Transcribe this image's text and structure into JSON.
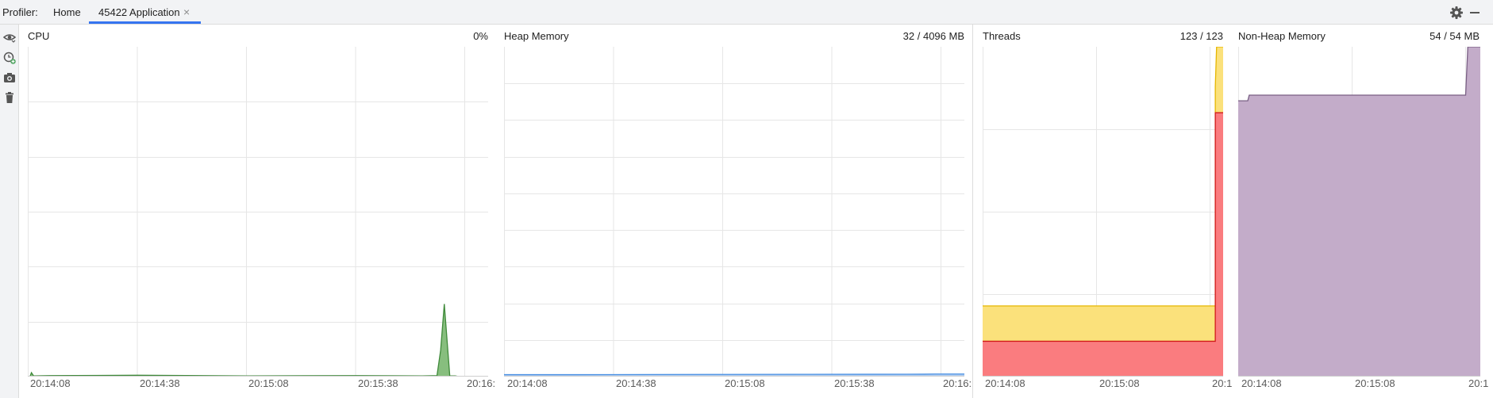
{
  "toolbar": {
    "profiler_label": "Profiler:",
    "tabs": [
      {
        "label": "Home"
      },
      {
        "label": "45422 Application",
        "active": true
      }
    ],
    "close_glyph": "×",
    "settings_icon": "gear-icon",
    "minimize_icon": "minimize-icon"
  },
  "left_toolbar": {
    "icons": [
      "eye-icon",
      "add-clock-icon",
      "camera-icon",
      "trash-icon"
    ]
  },
  "colors": {
    "cpu": "#5fa853",
    "heap": "#4a90e2",
    "threads_running": "#fa7c7f",
    "threads_waiting": "#fbe17b",
    "nonheap": "#c3acc9",
    "grid": "#e6e6e6"
  },
  "panels": {
    "cpu": {
      "title": "CPU",
      "value": "0%",
      "ticks": [
        "20:14:08",
        "20:14:38",
        "20:15:08",
        "20:15:38",
        "20:16:"
      ]
    },
    "heap": {
      "title": "Heap Memory",
      "value": "32 / 4096 MB",
      "ticks": [
        "20:14:08",
        "20:14:38",
        "20:15:08",
        "20:15:38",
        "20:16:"
      ]
    },
    "threads": {
      "title": "Threads",
      "value": "123 / 123",
      "ticks": [
        "20:14:08",
        "20:15:08",
        "20:1"
      ]
    },
    "nonheap": {
      "title": "Non-Heap Memory",
      "value": "54 / 54 MB",
      "ticks": [
        "20:14:08",
        "20:15:08",
        "20:1"
      ]
    }
  },
  "chart_data": [
    {
      "type": "area",
      "title": "CPU",
      "x_ticks": [
        "20:14:08",
        "20:14:38",
        "20:15:08",
        "20:15:38",
        "20:16:"
      ],
      "ylim": [
        0,
        100
      ],
      "series": [
        {
          "x": [
            0,
            0.6,
            1.0,
            1.6,
            6,
            30,
            60,
            90,
            108,
            112,
            113,
            114,
            115.5,
            117,
            118,
            119,
            120,
            126
          ],
          "values": [
            0,
            0,
            1.2,
            0.2,
            0.3,
            0.4,
            0.2,
            0.3,
            0.2,
            0.3,
            8,
            22,
            0.2,
            0.2,
            0,
            0,
            0,
            0
          ]
        }
      ]
    },
    {
      "type": "area",
      "title": "Heap Memory",
      "x_ticks": [
        "20:14:08",
        "20:14:38",
        "20:15:08",
        "20:15:38",
        "20:16:"
      ],
      "ylim": [
        0,
        4096
      ],
      "series": [
        {
          "x": [
            0,
            20,
            40,
            60,
            80,
            100,
            115,
            118,
            120,
            126
          ],
          "values": [
            24,
            24,
            26,
            27,
            28,
            29,
            30,
            32,
            32,
            32
          ]
        }
      ]
    },
    {
      "type": "area",
      "title": "Threads",
      "x_ticks": [
        "20:14:08",
        "20:15:08",
        "20:1"
      ],
      "ylim": [
        0,
        140
      ],
      "series": [
        {
          "x": [
            0,
            89.0,
            89.0,
            89.5,
            92
          ],
          "values": [
            15,
            15,
            112,
            112,
            112
          ]
        },
        {
          "x": [
            0,
            89.0,
            89.0,
            89.5,
            92
          ],
          "values": [
            30,
            30,
            123,
            140,
            140
          ]
        }
      ]
    },
    {
      "type": "area",
      "title": "Non-Heap Memory",
      "x_ticks": [
        "20:14:08",
        "20:15:08",
        "20:1"
      ],
      "ylim": [
        0,
        58
      ],
      "series": [
        {
          "x": [
            0,
            2.6,
            3.0,
            62,
            62.6,
            66
          ],
          "values": [
            48.5,
            48.5,
            49.5,
            49.5,
            58,
            58
          ]
        }
      ]
    }
  ]
}
